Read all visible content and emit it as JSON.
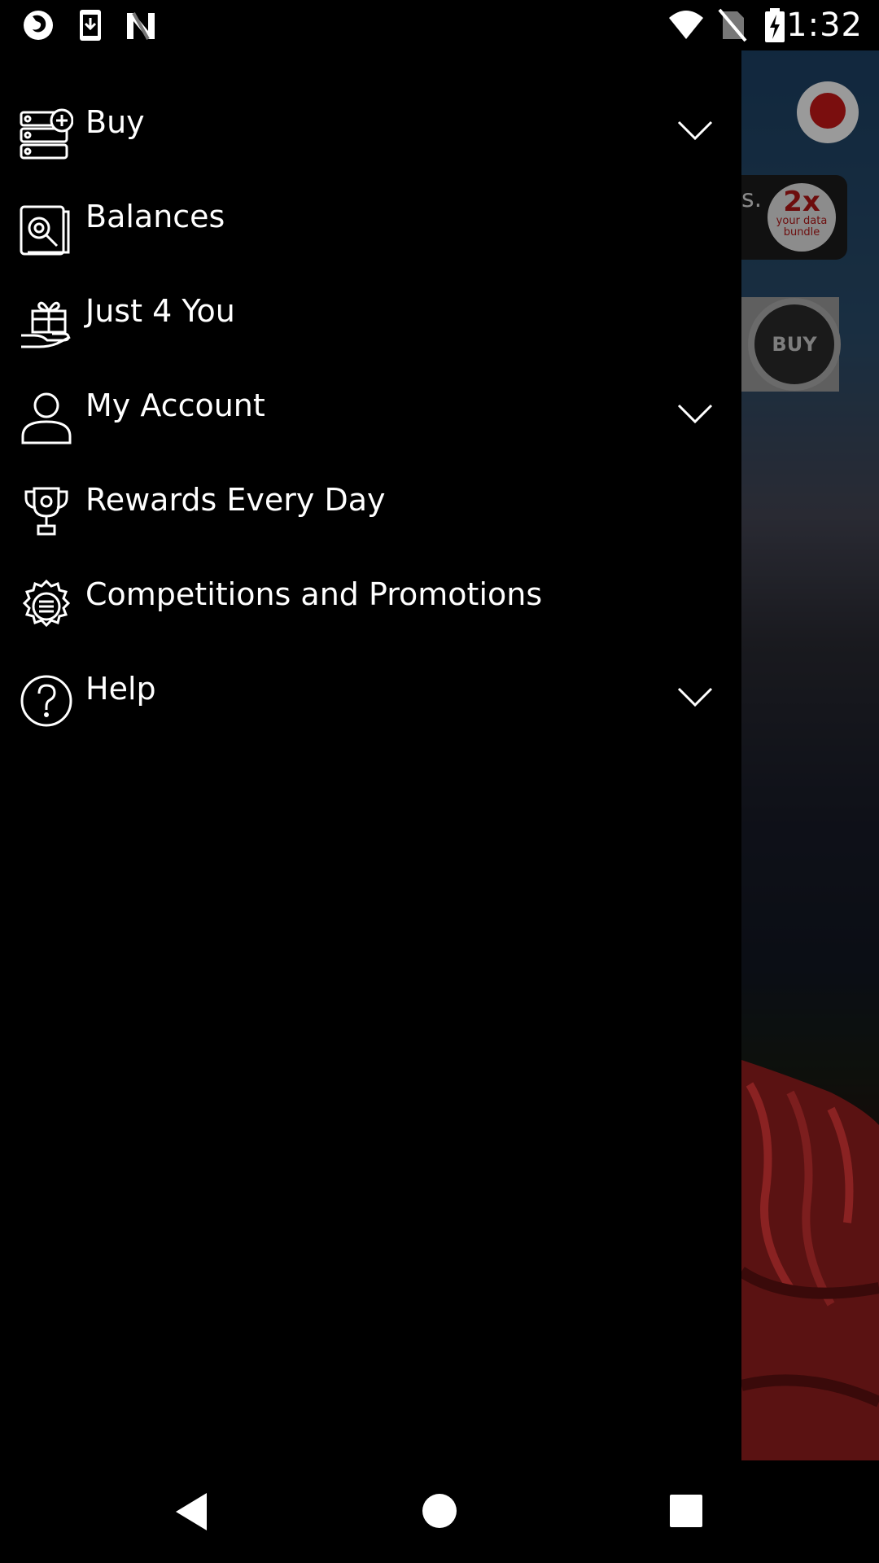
{
  "status_bar": {
    "time": "1:32",
    "left_icons": [
      "firefox-icon",
      "download-icon",
      "n-icon"
    ],
    "right_icons": [
      "wifi-icon",
      "no-sim-icon",
      "battery-charging-icon"
    ]
  },
  "drawer": {
    "items": [
      {
        "label": "Buy",
        "icon": "buy-list-icon",
        "expandable": true
      },
      {
        "label": "Balances",
        "icon": "balances-icon",
        "expandable": false
      },
      {
        "label": "Just 4 You",
        "icon": "gift-icon",
        "expandable": false
      },
      {
        "label": "My Account",
        "icon": "user-icon",
        "expandable": true
      },
      {
        "label": "Rewards Every Day",
        "icon": "trophy-icon",
        "expandable": false
      },
      {
        "label": "Competitions and Promotions",
        "icon": "badge-icon",
        "expandable": false
      },
      {
        "label": "Help",
        "icon": "help-icon",
        "expandable": true
      }
    ]
  },
  "background_app": {
    "banner_partial_text": "s.",
    "badge_big": "2x",
    "badge_small_1": "your data",
    "badge_small_2": "bundle",
    "buy_label": "BUY"
  },
  "colors": {
    "drawer_bg": "#000000",
    "text": "#ffffff",
    "brand_red": "#e60000"
  }
}
